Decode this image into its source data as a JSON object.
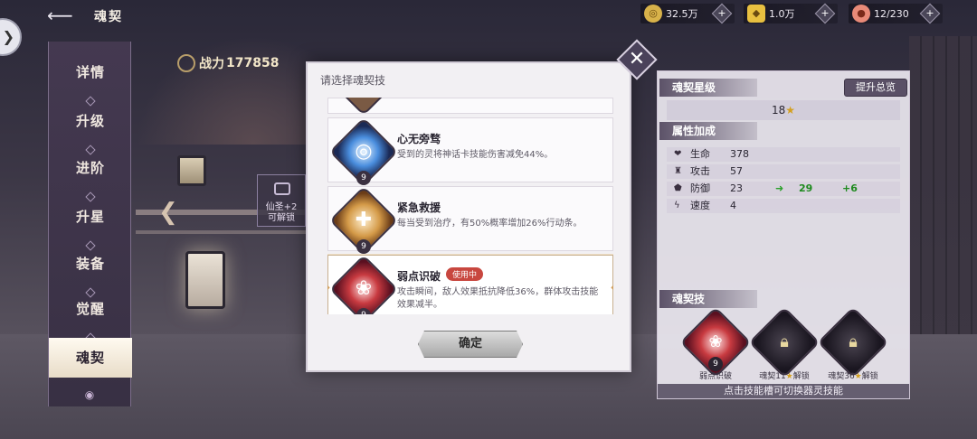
{
  "header": {
    "back_icon": "back-arrow-icon",
    "title": "魂契"
  },
  "resources": [
    {
      "icon": "coin-icon",
      "value": "32.5万",
      "color": "#d8b24a"
    },
    {
      "icon": "gold-ingot-icon",
      "value": "1.0万",
      "color": "#e8c040"
    },
    {
      "icon": "peach-icon",
      "value": "12/230",
      "color": "#e88a78"
    }
  ],
  "left_menu": {
    "items": [
      {
        "label": "详情"
      },
      {
        "label": "升级"
      },
      {
        "label": "进阶"
      },
      {
        "label": "升星"
      },
      {
        "label": "装备"
      },
      {
        "label": "觉醒"
      },
      {
        "label": "魂契"
      }
    ],
    "active_index": 6
  },
  "power": {
    "label": "战力",
    "value": "177858"
  },
  "side_tab": {
    "line1": "仙圣+2",
    "line2": "可解锁"
  },
  "modal": {
    "title": "请选择魂契技",
    "close_icon": "close-icon",
    "skills": [
      {
        "name": "心无旁骛",
        "desc": "受到的灵将神话卡技能伤害减免44%。",
        "level": "9",
        "icon": "blue-ring-icon",
        "selected": false
      },
      {
        "name": "紧急救援",
        "desc": "每当受到治疗，有50%概率增加26%行动条。",
        "level": "9",
        "icon": "heal-cross-icon",
        "selected": false
      },
      {
        "name": "弱点识破",
        "desc": "攻击瞬间，敌人效果抵抗降低36%，群体攻击技能效果减半。",
        "level": "9",
        "icon": "red-swirl-icon",
        "selected": true,
        "badge": "使用中"
      }
    ],
    "confirm_label": "确定"
  },
  "right_panel": {
    "star_section": {
      "header": "魂契星级",
      "button": "提升总览",
      "stars": "18"
    },
    "attr_section": {
      "header": "属性加成",
      "rows": [
        {
          "name": "生命",
          "value": "378",
          "icon": "heart-icon"
        },
        {
          "name": "攻击",
          "value": "57",
          "icon": "sword-icon"
        },
        {
          "name": "防御",
          "value": "23",
          "icon": "shield-icon",
          "new_value": "29",
          "diff": "+6"
        },
        {
          "name": "速度",
          "value": "4",
          "icon": "lightning-icon"
        }
      ]
    },
    "skill_section": {
      "header": "魂契技",
      "slots": [
        {
          "label": "弱点识破",
          "level": "9",
          "state": "equipped"
        },
        {
          "label_prefix": "魂契11",
          "label_suffix": "解锁",
          "state": "locked"
        },
        {
          "label_prefix": "魂契36",
          "label_suffix": "解锁",
          "state": "locked"
        }
      ],
      "hint": "点击技能槽可切换器灵技能"
    }
  }
}
